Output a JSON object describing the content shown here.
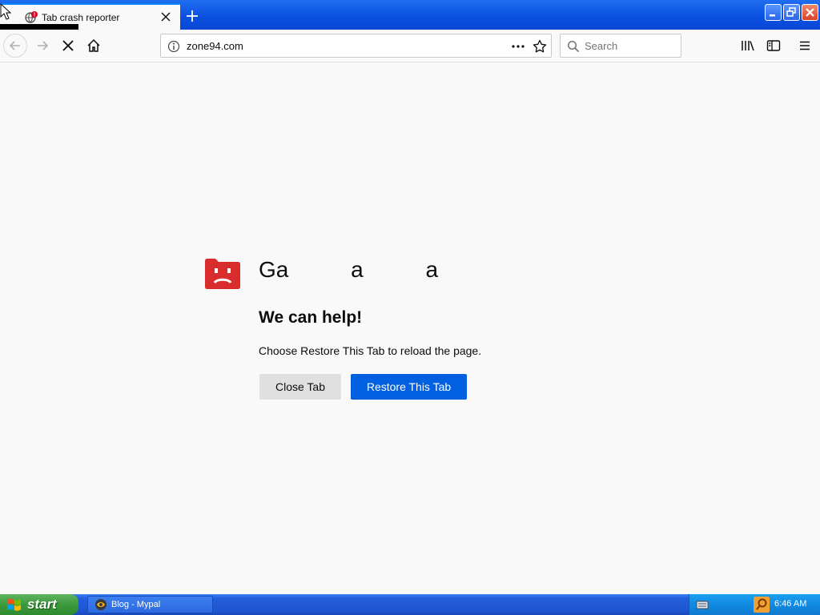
{
  "browser": {
    "tab": {
      "title": "Tab crash reporter",
      "badge": "!"
    },
    "url": "zone94.com",
    "search_placeholder": "Search",
    "icons": [
      "back-arrow-icon",
      "forward-arrow-icon",
      "stop-icon",
      "home-icon",
      "info-icon",
      "page-actions-icon",
      "bookmark-star-icon",
      "search-icon",
      "library-icon",
      "sidebar-icon",
      "menu-icon"
    ]
  },
  "crash": {
    "title": "Ga          a          a",
    "help_heading": "We can help!",
    "help_text": "Choose Restore This Tab to reload the page.",
    "close_label": "Close Tab",
    "restore_label": "Restore This Tab"
  },
  "taskbar": {
    "start_label": "start",
    "task_label": "Blog - Mypal",
    "clock": "6:46 AM"
  },
  "colors": {
    "accent": "#0060df",
    "crash_icon": "#d92d2d",
    "tab_strip": "#0b4fe0",
    "taskbar": "#245edb"
  }
}
